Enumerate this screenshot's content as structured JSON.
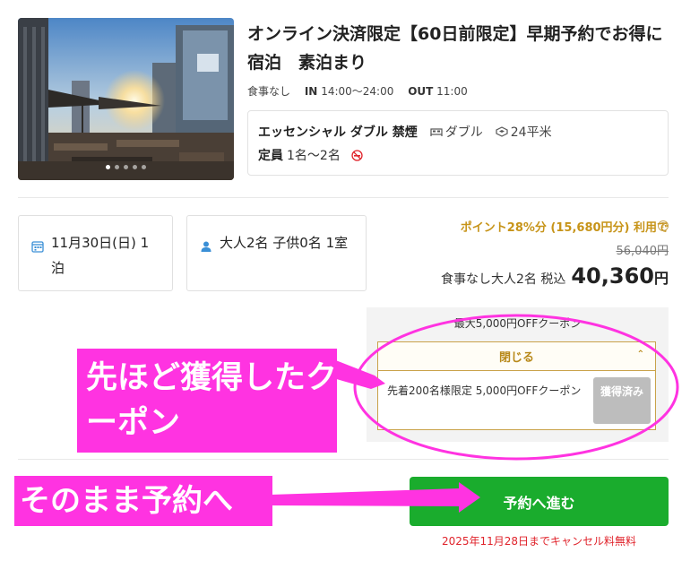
{
  "photo": {
    "alt": "hotel terrace photo",
    "slide_count": 5,
    "active_slide": 1
  },
  "plan": {
    "title": "オンライン決済限定【60日前限定】早期予約でお得に宿泊　素泊まり",
    "meal": "食事なし",
    "checkin_label": "IN",
    "checkin_value": "14:00〜24:00",
    "checkout_label": "OUT",
    "checkout_value": "11:00"
  },
  "room": {
    "name": "エッセンシャル ダブル 禁煙",
    "bed_type": "ダブル",
    "size": "24平米",
    "capacity_label": "定員",
    "capacity_value": "1名〜2名",
    "bed_icon": "bed-icon",
    "area_icon": "room-size-icon",
    "smoking_icon": "no-smoking-icon"
  },
  "selection": {
    "date": "11月30日(日) 1泊",
    "date_icon": "calendar-icon",
    "guests": "大人2名 子供0名 1室",
    "guests_icon": "person-icon"
  },
  "pricing": {
    "points_text": "ポイント28%分 (15,680円分) 利用で",
    "help_icon": "?",
    "original_price": "56,040円",
    "price_label": "食事なし大人2名 税込",
    "price_value": "40,360",
    "price_unit": "円"
  },
  "coupon": {
    "header": "最大5,000円OFFクーポン",
    "close_label": "閉じる",
    "item_text": "先着200名様限定 5,000円OFFクーポン",
    "acquired_label": "獲得済み"
  },
  "reserve": {
    "button_label": "予約へ進む",
    "cancel_note": "2025年11月28日までキャンセル料無料"
  },
  "annotations": {
    "coupon_note": "先ほど獲得したクーポン",
    "reserve_note": "そのまま予約へ",
    "accent_color": "#ff33e1"
  },
  "colors": {
    "reserve_green": "#1aac2d",
    "gold": "#c79419",
    "cancel_red": "#e0242c"
  }
}
